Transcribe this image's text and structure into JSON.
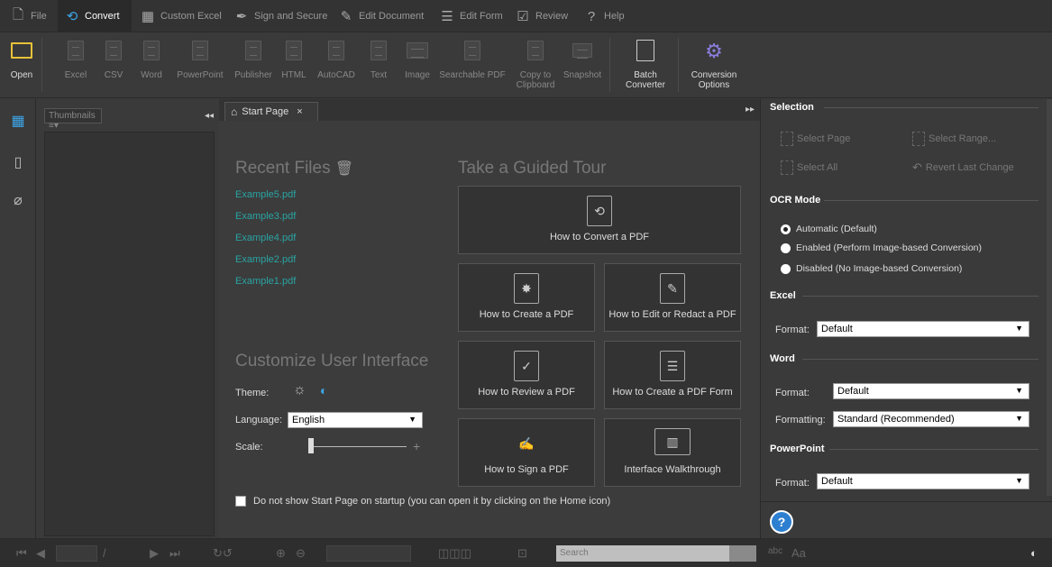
{
  "menubar": {
    "items": [
      {
        "label": "File",
        "icon": "file-icon"
      },
      {
        "label": "Convert",
        "icon": "convert-icon"
      },
      {
        "label": "Custom Excel",
        "icon": "grid-icon"
      },
      {
        "label": "Sign and Secure",
        "icon": "pen-icon"
      },
      {
        "label": "Edit Document",
        "icon": "edit-icon"
      },
      {
        "label": "Edit Form",
        "icon": "form-icon"
      },
      {
        "label": "Review",
        "icon": "check-icon"
      },
      {
        "label": "Help",
        "icon": "help-icon"
      }
    ]
  },
  "ribbon": {
    "open": "Open",
    "excel": "Excel",
    "csv": "CSV",
    "word": "Word",
    "powerpoint": "PowerPoint",
    "publisher": "Publisher",
    "html": "HTML",
    "autocad": "AutoCAD",
    "text": "Text",
    "image": "Image",
    "searchable_pdf": "Searchable PDF",
    "copy1": "Copy to",
    "copy2": "Clipboard",
    "snapshot": "Snapshot",
    "batch1": "Batch",
    "batch2": "Converter",
    "conv1": "Conversion",
    "conv2": "Options"
  },
  "thumbs": {
    "dropdown": "Thumbnails ≡▾"
  },
  "tab": {
    "label": "Start Page",
    "close": "×"
  },
  "startpage": {
    "recent_title": "Recent Files",
    "recent_files": [
      "Example5.pdf",
      "Example3.pdf",
      "Example4.pdf",
      "Example2.pdf",
      "Example1.pdf"
    ],
    "tour_title": "Take a Guided Tour",
    "tours": {
      "convert": "How to Convert a PDF",
      "create": "How to Create a PDF",
      "edit": "How to Edit or Redact a PDF",
      "review": "How to Review a PDF",
      "form": "How to Create a PDF Form",
      "sign": "How to Sign a PDF",
      "walkthrough": "Interface Walkthrough"
    },
    "customize_title": "Customize User Interface",
    "theme_label": "Theme:",
    "language_label": "Language:",
    "language_value": "English",
    "scale_label": "Scale:",
    "no_show": "Do not show Start Page on startup (you can open it by clicking on the Home icon)"
  },
  "rightpanel": {
    "selection_title": "Selection",
    "select_page": "Select Page",
    "select_range": "Select Range...",
    "select_all": "Select All",
    "revert": "Revert Last Change",
    "ocr_title": "OCR Mode",
    "ocr_options": [
      "Automatic (Default)",
      "Enabled (Perform Image-based Conversion)",
      "Disabled (No Image-based Conversion)"
    ],
    "ocr_selected": 0,
    "excel_title": "Excel",
    "excel_format_label": "Format:",
    "excel_format_value": "Default",
    "word_title": "Word",
    "word_format_label": "Format:",
    "word_format_value": "Default",
    "word_formatting_label": "Formatting:",
    "word_formatting_value": "Standard (Recommended)",
    "ppt_title": "PowerPoint",
    "ppt_format_label": "Format:",
    "ppt_format_value": "Default"
  },
  "statusbar": {
    "page_sep": "/",
    "search_placeholder": "Search",
    "case_label": "Aa",
    "abc_label": "abc"
  },
  "colors": {
    "accent": "#3ea6e8",
    "link": "#2aa3a3",
    "help": "#2d7fd0"
  }
}
